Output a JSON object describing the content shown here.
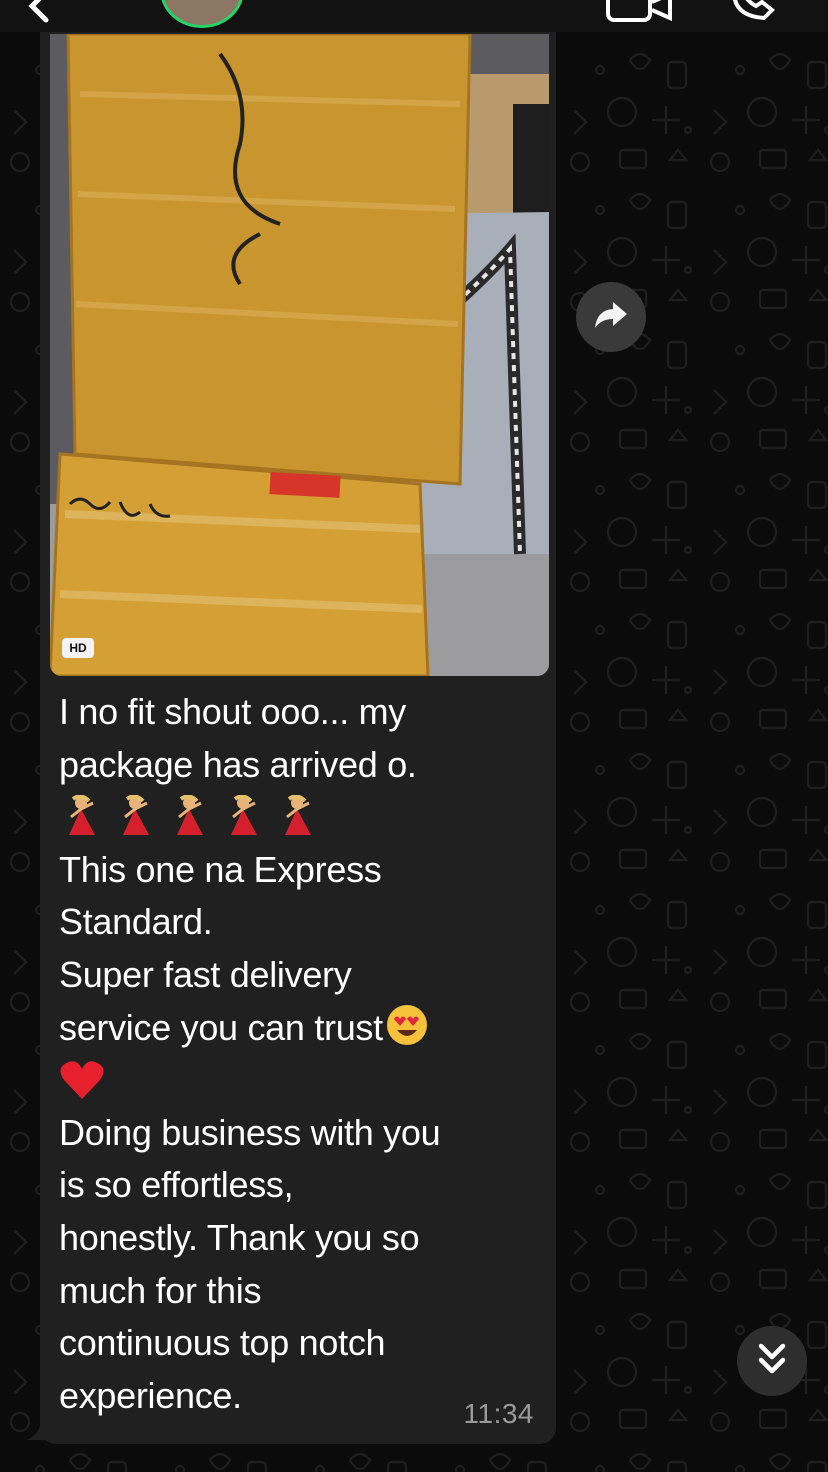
{
  "message": {
    "image_badge": "HD",
    "lines": [
      "I no fit shout ooo... my",
      "package has arrived o."
    ],
    "lines_after_emoji": [
      "This one na Express",
      "Standard.",
      "Super fast delivery"
    ],
    "trust_line": "service you can trust",
    "closing_lines": [
      "Doing business with you",
      "is so effortless,",
      "honestly. Thank you so",
      "much for this",
      "continuous top notch",
      "experience."
    ],
    "time": "11:34",
    "emojis": [
      "dancer-emoji",
      "dancer-emoji",
      "dancer-emoji",
      "dancer-emoji",
      "dancer-emoji",
      "heart-eyes-emoji",
      "red-heart-emoji"
    ]
  },
  "colors": {
    "background": "#0b0b0b",
    "bubble": "#202020",
    "text": "#ffffff",
    "timestamp": "#9a9a9a",
    "avatar_ring": "#25d366",
    "box_tan": "#c9952f"
  },
  "icons": {
    "back": "chevron-left-icon",
    "video_call": "video-camera-icon",
    "voice_call": "phone-icon",
    "forward": "forward-arrow-icon",
    "scroll_down": "double-chevron-down-icon"
  }
}
